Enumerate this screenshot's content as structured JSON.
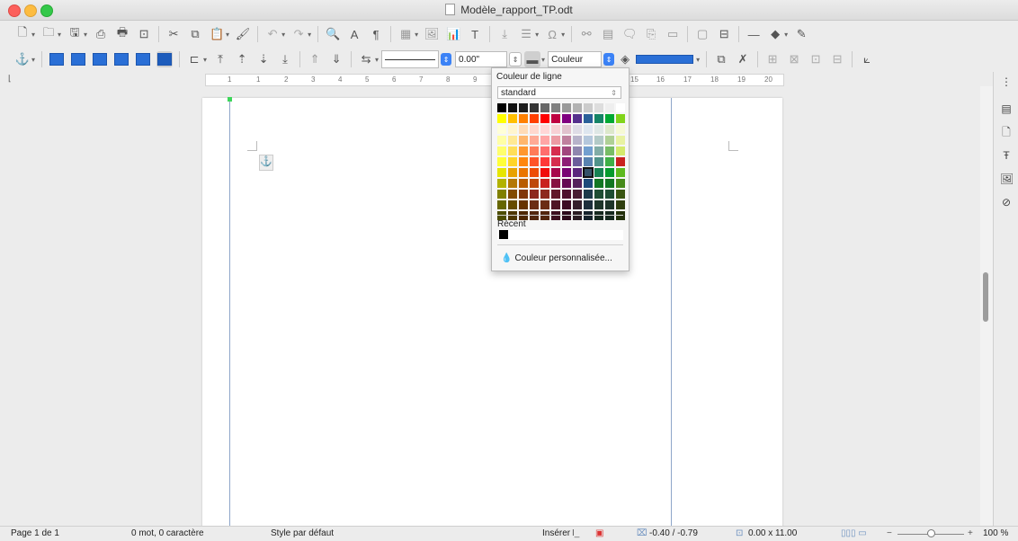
{
  "window": {
    "title": "Modèle_rapport_TP.odt"
  },
  "toolbar2": {
    "line_width_value": "0.00\"",
    "color_mode": "Couleur"
  },
  "ruler": {
    "numbers": [
      "1",
      "1",
      "2",
      "3",
      "4",
      "5",
      "6",
      "7",
      "8",
      "9",
      "15",
      "16",
      "17",
      "18",
      "19",
      "20"
    ]
  },
  "popup": {
    "title": "Couleur de ligne",
    "palette_name": "standard",
    "recent_label": "Récent",
    "custom_label": "Couleur personnalisée...",
    "selected_color": "#355269",
    "recent_colors": [
      "#000000"
    ],
    "swatches": [
      [
        "#000000",
        "#111111",
        "#1c1c1c",
        "#333333",
        "#666666",
        "#808080",
        "#999999",
        "#b2b2b2",
        "#cccccc",
        "#dddddd",
        "#eeeeee",
        "#ffffff"
      ],
      [
        "#ffff00",
        "#ffbf00",
        "#ff8000",
        "#ff4000",
        "#ff0000",
        "#bf0041",
        "#800080",
        "#55308d",
        "#2a6099",
        "#158466",
        "#00a933",
        "#81d41a"
      ],
      [
        "#ffffd7",
        "#fff5ce",
        "#ffdbb6",
        "#ffd8ce",
        "#ffd7d7",
        "#f7d1d5",
        "#e0c2cd",
        "#dedce6",
        "#dee6ef",
        "#dee7e5",
        "#dde8cb",
        "#f6f9d4"
      ],
      [
        "#ffffa6",
        "#ffe994",
        "#ffb66c",
        "#ffaa95",
        "#ffa6a6",
        "#ec9ba4",
        "#bf819e",
        "#b7b3ca",
        "#b4c7dc",
        "#b3cac7",
        "#afd095",
        "#e8f2a1"
      ],
      [
        "#ffff6d",
        "#ffde59",
        "#ff972f",
        "#ff7b59",
        "#ff6d6d",
        "#d62e4e",
        "#a1467e",
        "#8e86ae",
        "#729fcf",
        "#81aca6",
        "#77bc65",
        "#d4ea6b"
      ],
      [
        "#ffff38",
        "#ffd428",
        "#ff860d",
        "#ff5429",
        "#ff3838",
        "#d62e4e",
        "#8d1d75",
        "#6b5e9b",
        "#5983b0",
        "#50938a",
        "#3faf46",
        "#c9211e"
      ],
      [
        "#e6e600",
        "#e8a202",
        "#ea7500",
        "#ed4c05",
        "#f10d0c",
        "#a7074b",
        "#780373",
        "#5b277d",
        "#355269",
        "#168253",
        "#069a2e",
        "#5eb91e"
      ],
      [
        "#b2b200",
        "#b47804",
        "#b85c00",
        "#be480a",
        "#c9211e",
        "#861141",
        "#650953",
        "#55215b",
        "#1e4a7a",
        "#127622",
        "#127622",
        "#468a1a"
      ],
      [
        "#808000",
        "#814a02",
        "#813709",
        "#8d281e",
        "#8d281e",
        "#611729",
        "#4e102d",
        "#481d32",
        "#1e3a4a",
        "#1e4d33",
        "#1e4d33",
        "#395511"
      ],
      [
        "#666600",
        "#664b00",
        "#663300",
        "#6b2d14",
        "#6b2d14",
        "#4e1424",
        "#3d0d24",
        "#351f2b",
        "#1e2e3b",
        "#1e3529",
        "#1e3529",
        "#2f3f0f"
      ],
      [
        "#4d4d00",
        "#4d3600",
        "#4d2600",
        "#52260d",
        "#52260d",
        "#3d0d1e",
        "#2e0a1c",
        "#291a21",
        "#16222c",
        "#16281f",
        "#16281f",
        "#23300b"
      ]
    ]
  },
  "status": {
    "page": "Page 1 de 1",
    "words": "0 mot, 0 caractère",
    "style": "Style par défaut",
    "insert_mode": "Insérer",
    "position": "-0.40 / -0.79",
    "size": "0.00 x 11.00",
    "zoom": "100 %"
  },
  "icons": {
    "tb1": [
      "new-doc-icon",
      "open-icon",
      "save-icon",
      "export-pdf-icon",
      "print-icon",
      "print-preview-icon",
      "cut-icon",
      "copy-icon",
      "paste-icon",
      "clone-formatting-icon",
      "undo-icon",
      "redo-icon",
      "find-replace-icon",
      "spelling-icon",
      "formatting-marks-icon",
      "table-icon",
      "image-icon",
      "chart-icon",
      "textbox-icon",
      "page-break-icon",
      "field-icon",
      "special-char-icon",
      "hyperlink-icon",
      "footnote-icon",
      "comment-icon",
      "track-changes-icon",
      "line-icon",
      "basic-shapes-icon",
      "draw-icon"
    ],
    "sidebar": [
      "properties-icon",
      "page-icon",
      "styles-icon",
      "gallery-icon",
      "navigator-icon"
    ]
  }
}
